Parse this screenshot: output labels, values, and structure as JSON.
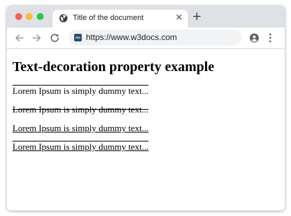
{
  "browser": {
    "tab": {
      "title": "Title of the document",
      "close_glyph": "×",
      "icon": "globe-icon"
    },
    "new_tab_glyph": "+",
    "toolbar": {
      "back_icon": "back-arrow-icon",
      "forward_icon": "forward-arrow-icon",
      "reload_icon": "reload-icon",
      "url": "https://www.w3docs.com",
      "profile_icon": "account-icon",
      "menu_icon": "kebab-menu-icon"
    },
    "window_controls": {
      "close_color": "#fd5c57",
      "minimize_color": "#fdbc2f",
      "maximize_color": "#28c840"
    }
  },
  "page": {
    "heading": "Text-decoration property example",
    "paragraphs": [
      {
        "text": "Lorem Ipsum is simply dummy text...",
        "decoration": "overline"
      },
      {
        "text": "Lorem Ipsum is simply dummy text...",
        "decoration": "line-through"
      },
      {
        "text": "Lorem Ipsum is simply dummy text...",
        "decoration": "underline"
      },
      {
        "text": "Lorem Ipsum is simply dummy text...",
        "decoration": "overline underline"
      }
    ]
  }
}
